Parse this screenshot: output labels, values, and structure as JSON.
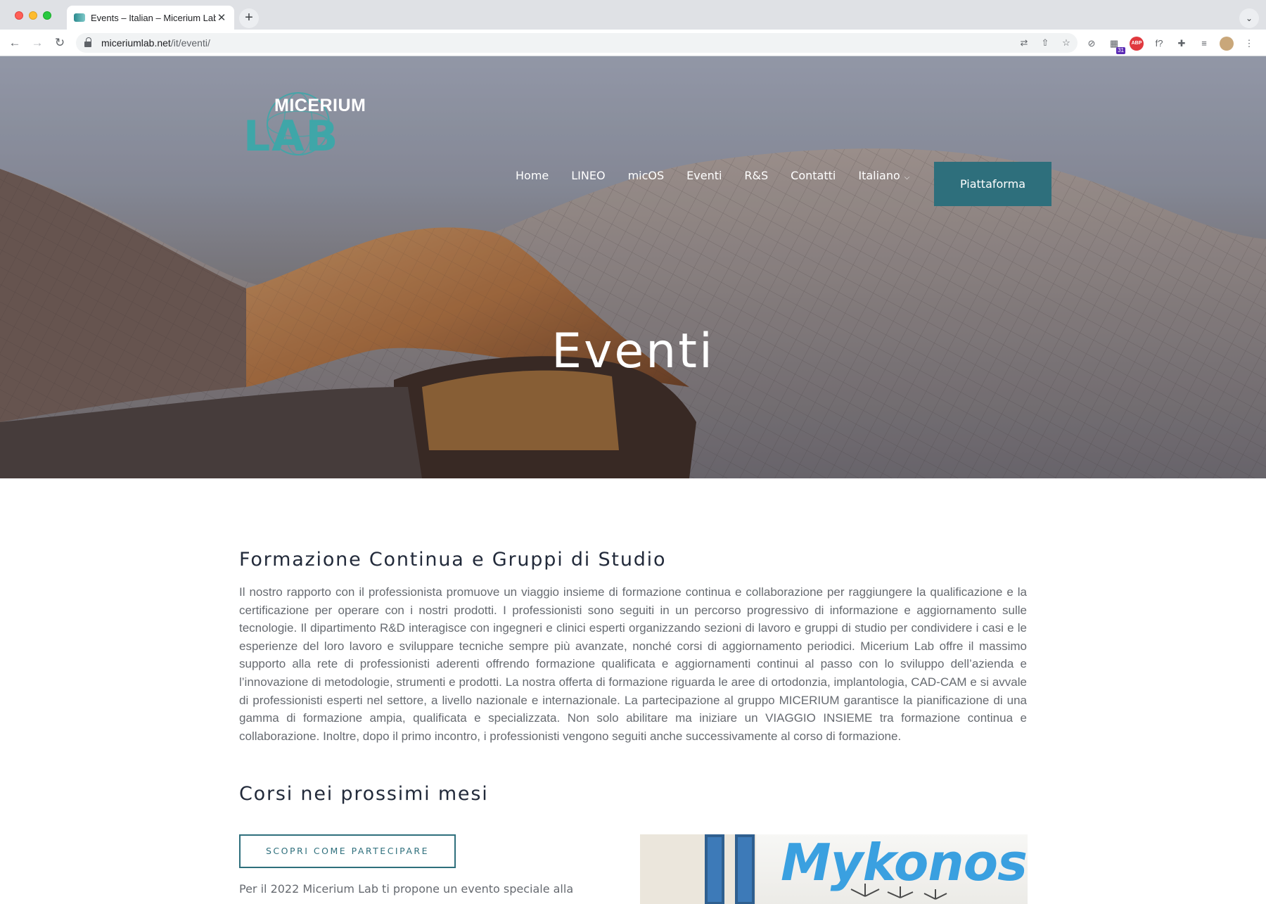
{
  "browser": {
    "tab_title": "Events – Italian – Micerium Lab",
    "tab_close": "✕",
    "new_tab": "+",
    "tab_menu": "⌄",
    "url_host": "miceriumlab.net",
    "url_path": "/it/eventi/",
    "extension_badge": "31",
    "extension_abp": "ABP",
    "extension_f": "f?"
  },
  "site": {
    "logo_top": "MICERIUM",
    "logo_bottom": "LAB",
    "nav": [
      "Home",
      "LINEO",
      "micOS",
      "Eventi",
      "R&S",
      "Contatti"
    ],
    "language": "Italiano",
    "cta": "Piattaforma"
  },
  "hero": {
    "title": "Eventi"
  },
  "main": {
    "heading1": "Formazione Continua e Gruppi di Studio",
    "paragraph": "Il nostro rapporto con il professionista promuove un viaggio insieme di formazione continua e collaborazione per raggiungere la qualificazione e la certificazione per operare con i nostri prodotti. I professionisti sono seguiti in un percorso progressivo di informazione e aggiornamento sulle tecnologie. Il dipartimento R&D interagisce con ingegneri e clinici esperti organizzando sezioni di lavoro e gruppi di studio per condividere i casi e le esperienze del loro lavoro e sviluppare tecniche sempre più avanzate, nonché corsi di aggiornamento periodici. Micerium Lab offre il massimo supporto alla rete di professionisti aderenti offrendo formazione qualificata e aggiornamenti continui al passo con lo sviluppo dell’azienda e l’innovazione di metodologie, strumenti e prodotti. La nostra offerta di formazione riguarda le aree di ortodonzia, implantologia, CAD-CAM e si avvale di professionisti esperti nel settore, a livello nazionale e internazionale. La partecipazione al gruppo MICERIUM garantisce la pianificazione di una gamma di formazione ampia, qualificata e specializzata. Non solo abilitare ma iniziare un VIAGGIO INSIEME tra formazione continua e collaborazione. Inoltre, dopo il primo incontro, i professionisti vengono seguiti anche successivamente al corso di formazione.",
    "heading2": "Corsi nei prossimi mesi",
    "button": "SCOPRI COME PARTECIPARE",
    "intro_text": "Per il 2022 Micerium Lab ti propone un evento speciale alla",
    "promo_title": "Mykonos"
  }
}
